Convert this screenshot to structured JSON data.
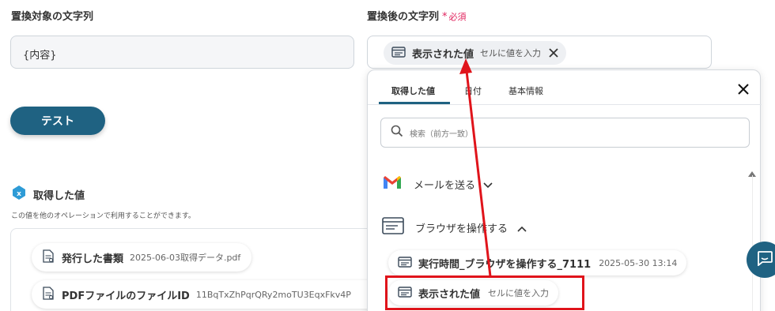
{
  "left_field": {
    "label": "置換対象の文字列",
    "value": "{内容}"
  },
  "right_field": {
    "label": "置換後の文字列",
    "required_star": "*",
    "required_text": "必須",
    "chip_main": "表示された値",
    "chip_sub": "セルに値を入力"
  },
  "test_button": {
    "label": "テスト"
  },
  "acquired_section": {
    "title": "取得した値",
    "description": "この値を他のオペレーションで利用することができます。",
    "items": [
      {
        "main": "発行した書類",
        "sub": "2025-06-03取得データ.pdf"
      },
      {
        "main": "PDFファイルのファイルID",
        "sub": "11BqTxZhPqrQRy2moTU3EqxFkv4P"
      }
    ]
  },
  "popup": {
    "tabs": [
      "取得した値",
      "日付",
      "基本情報"
    ],
    "active_tab": 0,
    "search_placeholder": "検索（前方一致）",
    "groups": [
      {
        "label": "メールを送る",
        "icon": "gmail-icon",
        "expanded": false
      },
      {
        "label": "ブラウザを操作する",
        "icon": "browser-icon",
        "expanded": true
      }
    ],
    "browser_items": [
      {
        "main": "実行時間_ブラウザを操作する_7111",
        "sub": "2025-05-30 13:14"
      },
      {
        "main": "表示された値",
        "sub": "セルに値を入力"
      }
    ]
  },
  "colors": {
    "accent": "#1f6282",
    "required": "#e0245e",
    "highlight": "#e0141b"
  }
}
